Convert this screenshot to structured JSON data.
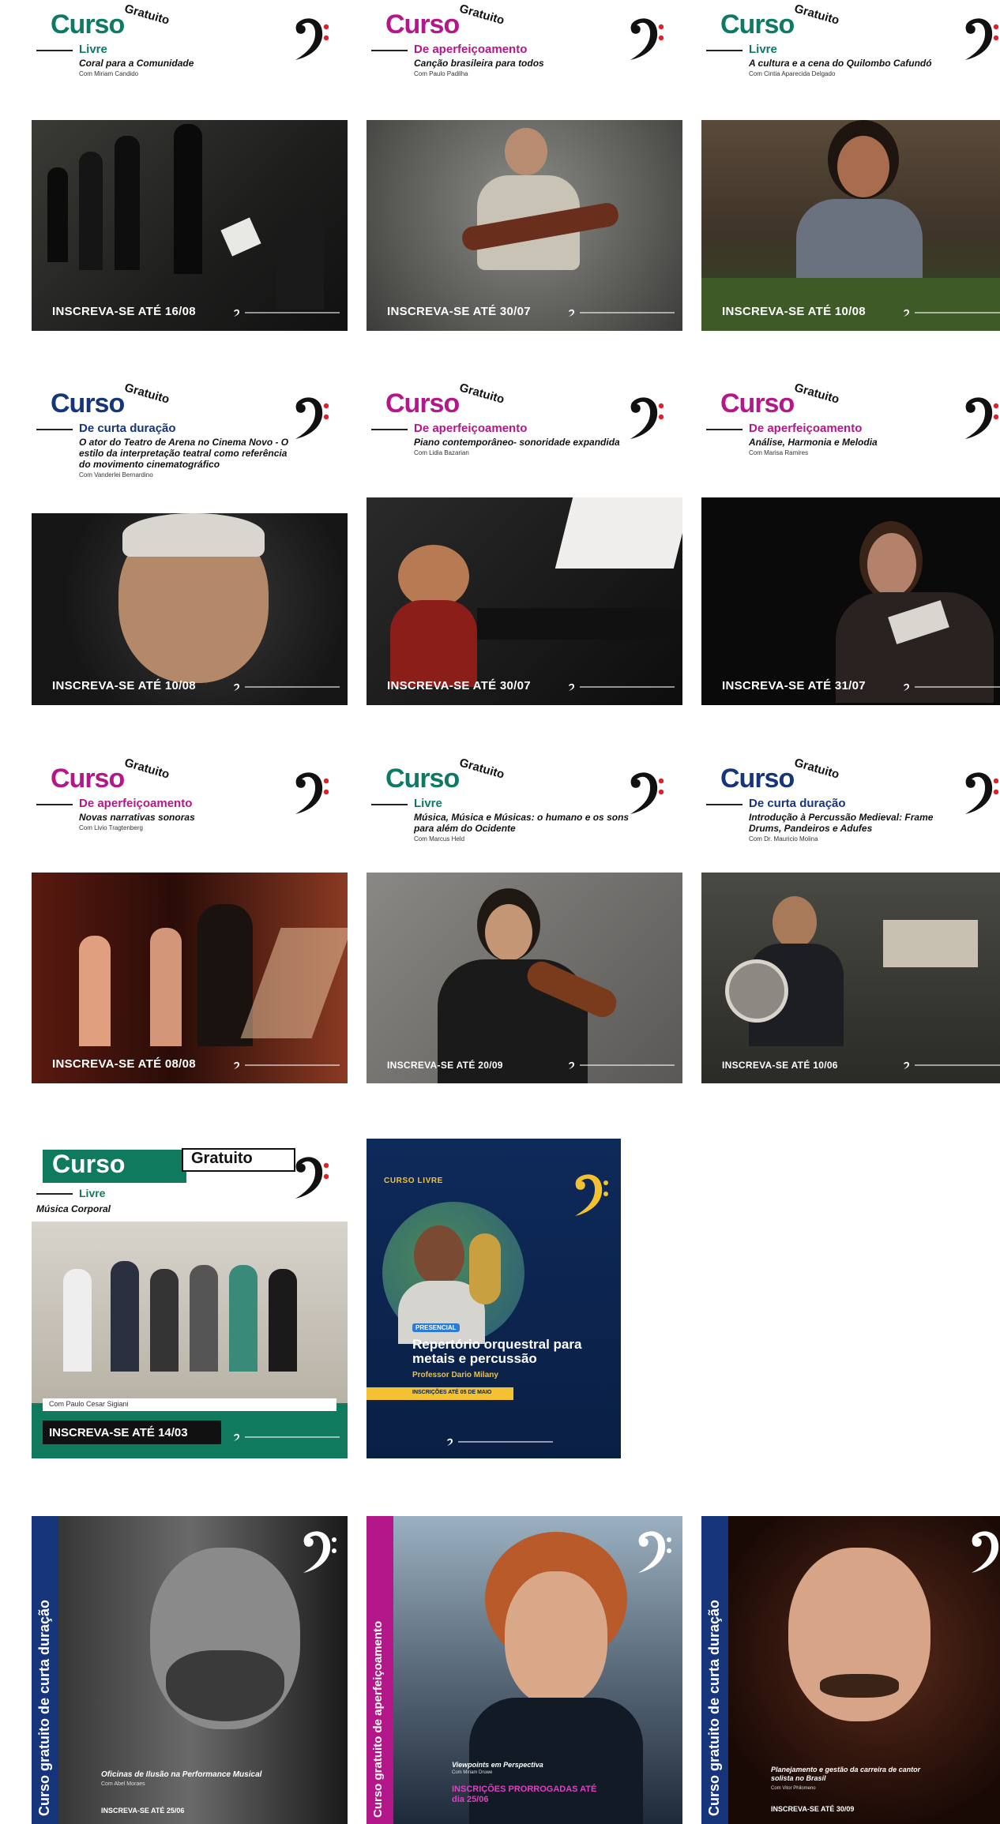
{
  "colors": {
    "teal": "#0e7a66",
    "magenta": "#b4178a",
    "navy": "#16357a",
    "green_dark": "#0f7a5e",
    "navy_card": "#0f2a57",
    "yellow": "#f4c230"
  },
  "logo_icon": "bass-clef-icon",
  "cards": [
    {
      "curso": "Curso",
      "gratuito": "Gratuito",
      "category": "Livre",
      "title": "Coral para a Comunidade",
      "instructor": "Com Miriam Candido",
      "cta": "INSCREVA-SE ATÉ 16/08"
    },
    {
      "curso": "Curso",
      "gratuito": "Gratuito",
      "category": "De aperfeiçoamento",
      "title": "Canção brasileira para todos",
      "instructor": "Com Paulo Padilha",
      "cta": "INSCREVA-SE ATÉ 30/07"
    },
    {
      "curso": "Curso",
      "gratuito": "Gratuito",
      "category": "Livre",
      "title": "A cultura e a cena do Quilombo Cafundó",
      "instructor": "Com Cintia Aparecida Delgado",
      "cta": "INSCREVA-SE ATÉ 10/08"
    },
    {
      "curso": "Curso",
      "gratuito": "Gratuito",
      "category": "De curta duração",
      "title": "O ator do Teatro de Arena no Cinema Novo - O estilo da interpretação teatral como referência do movimento cinematográfico",
      "instructor": "Com Vanderlei Bernardino",
      "cta": "INSCREVA-SE ATÉ 10/08"
    },
    {
      "curso": "Curso",
      "gratuito": "Gratuito",
      "category": "De aperfeiçoamento",
      "title": "Piano contemporâneo- sonoridade expandida",
      "instructor": "Com Lidia Bazarian",
      "cta": "INSCREVA-SE ATÉ 30/07"
    },
    {
      "curso": "Curso",
      "gratuito": "Gratuito",
      "category": "De aperfeiçoamento",
      "title": "Análise, Harmonia e Melodia",
      "instructor": "Com Marisa Ramires",
      "cta": "INSCREVA-SE ATÉ 31/07"
    },
    {
      "curso": "Curso",
      "gratuito": "Gratuito",
      "category": "De aperfeiçoamento",
      "title": "Novas narrativas sonoras",
      "instructor": "Com Livio Tragtenberg",
      "cta": "INSCREVA-SE ATÉ 08/08"
    },
    {
      "curso": "Curso",
      "gratuito": "Gratuito",
      "category": "Livre",
      "title": "Música, Música e Músicas: o humano e os sons para além do Ocidente",
      "instructor": "Com Marcus Held",
      "cta": "INSCREVA-SE ATÉ 20/09"
    },
    {
      "curso": "Curso",
      "gratuito": "Gratuito",
      "category": "De curta duração",
      "title": "Introdução à Percussão Medieval: Frame Drums, Pandeiros e Adufes",
      "instructor": "Com Dr. Mauricio Molina",
      "cta": "INSCREVA-SE ATÉ 10/06"
    }
  ],
  "card10": {
    "curso": "Curso",
    "gratuito": "Gratuito",
    "category": "Livre",
    "title": "Música Corporal",
    "instructor": "Com Paulo Cesar Sigiani",
    "cta": "INSCREVA-SE ATÉ 14/03"
  },
  "card11": {
    "tag": "CURSO LIVRE",
    "badge": "PRESENCIAL",
    "title": "Repertório orquestral para metais e percussão",
    "professor": "Professor Dario Milany",
    "cta": "INSCRIÇÕES ATÉ 05 DE MAIO"
  },
  "bottom": [
    {
      "vertical": "Curso gratuito de curta duração",
      "title": "Oficinas de Ilusão na Performance Musical",
      "instructor": "Com Abel Moraes",
      "cta": "INSCREVA-SE ATÉ 25/06"
    },
    {
      "vertical": "Curso gratuito de aperfeiçoamento",
      "title": "Viewpoints em Perspectiva",
      "instructor": "Com Miriam Druwe",
      "promo": "INSCRIÇÕES PRORROGADAS ATÉ dia 25/06"
    },
    {
      "vertical": "Curso gratuito de curta duração",
      "title": "Planejamento e gestão da carreira de cantor solista no Brasil",
      "instructor": "Com Vitor Philomeno",
      "cta": "INSCREVA-SE ATÉ 30/09"
    }
  ]
}
